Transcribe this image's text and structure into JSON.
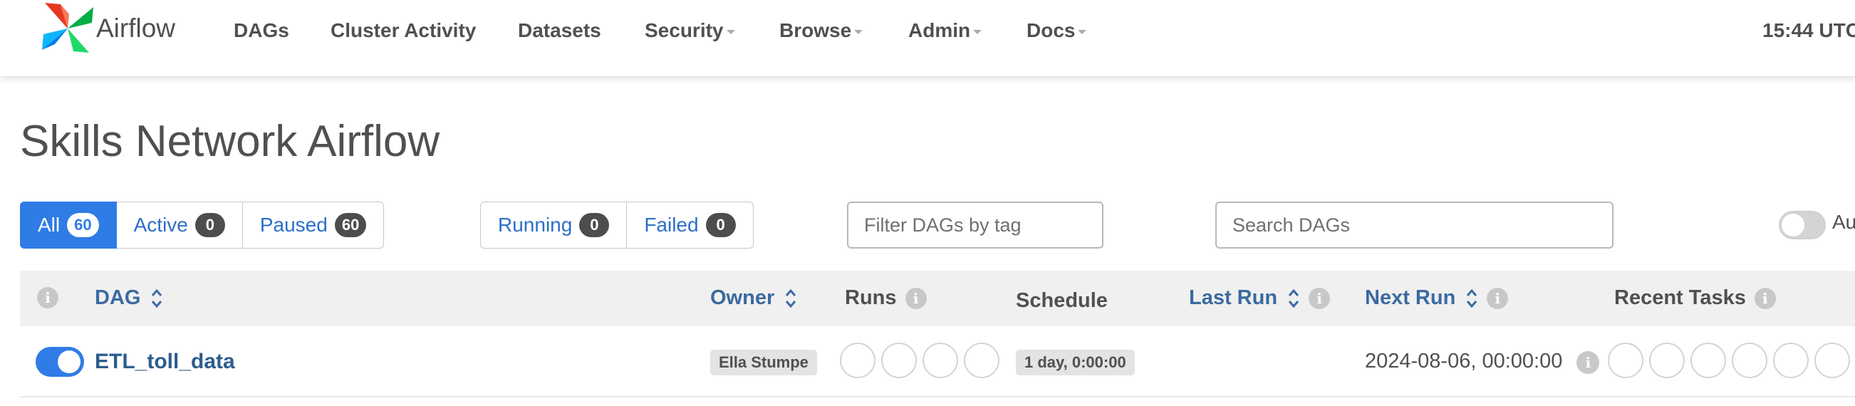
{
  "navbar": {
    "brand": "Airflow",
    "items": [
      {
        "label": "DAGs",
        "dropdown": false
      },
      {
        "label": "Cluster Activity",
        "dropdown": false
      },
      {
        "label": "Datasets",
        "dropdown": false
      },
      {
        "label": "Security",
        "dropdown": true
      },
      {
        "label": "Browse",
        "dropdown": true
      },
      {
        "label": "Admin",
        "dropdown": true
      },
      {
        "label": "Docs",
        "dropdown": true
      }
    ],
    "clock": "15:44 UTC"
  },
  "page": {
    "title": "Skills Network Airflow"
  },
  "filters": {
    "status_tabs": [
      {
        "label": "All",
        "count": "60",
        "active": true
      },
      {
        "label": "Active",
        "count": "0",
        "active": false
      },
      {
        "label": "Paused",
        "count": "60",
        "active": false
      }
    ],
    "run_tabs": [
      {
        "label": "Running",
        "count": "0"
      },
      {
        "label": "Failed",
        "count": "0"
      }
    ],
    "tag_filter_placeholder": "Filter DAGs by tag",
    "search_placeholder": "Search DAGs",
    "auto_refresh_label": "Au"
  },
  "table": {
    "headers": {
      "dag": "DAG",
      "owner": "Owner",
      "runs": "Runs",
      "schedule": "Schedule",
      "last_run": "Last Run",
      "next_run": "Next Run",
      "recent_tasks": "Recent Tasks"
    },
    "rows": [
      {
        "dag_id": "ETL_toll_data",
        "paused": false,
        "owner": "Ella Stumpe",
        "schedule": "1 day, 0:00:00",
        "last_run": "",
        "next_run": "2024-08-06, 00:00:00"
      }
    ]
  },
  "colors": {
    "accent": "#2f7ce6",
    "link": "#2d5d8d",
    "text": "#51504f",
    "badge_dark": "#4d4d4d"
  }
}
